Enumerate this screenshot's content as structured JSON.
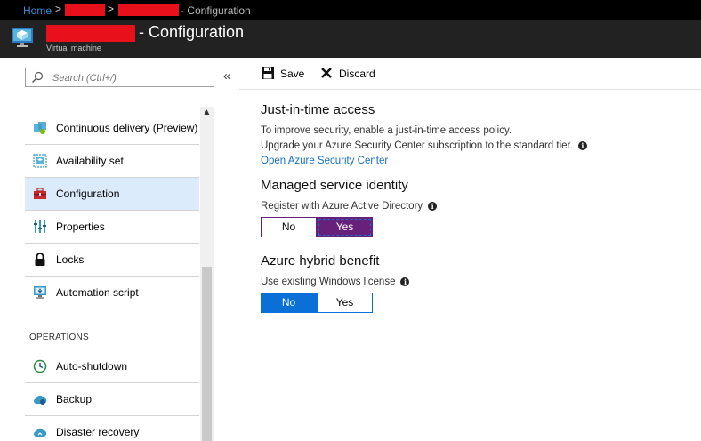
{
  "breadcrumb": {
    "home": "Home",
    "separator": ">",
    "current": "- Configuration"
  },
  "header": {
    "title_suffix": "- Configuration",
    "subtitle": "Virtual machine"
  },
  "sidebar": {
    "search_placeholder": "Search (Ctrl+/)",
    "collapse": "«",
    "items": [
      {
        "label": "Continuous delivery (Preview)",
        "icon": "continuous-delivery-icon"
      },
      {
        "label": "Availability set",
        "icon": "availability-set-icon"
      },
      {
        "label": "Configuration",
        "icon": "toolbox-icon",
        "active": true
      },
      {
        "label": "Properties",
        "icon": "properties-icon"
      },
      {
        "label": "Locks",
        "icon": "lock-icon"
      },
      {
        "label": "Automation script",
        "icon": "automation-script-icon"
      }
    ],
    "section_operations": "OPERATIONS",
    "operations_items": [
      {
        "label": "Auto-shutdown",
        "icon": "clock-icon"
      },
      {
        "label": "Backup",
        "icon": "cloud-backup-icon"
      },
      {
        "label": "Disaster recovery",
        "icon": "cloud-recovery-icon"
      }
    ]
  },
  "toolbar": {
    "save_label": "Save",
    "discard_label": "Discard"
  },
  "main": {
    "jit": {
      "title": "Just-in-time access",
      "line1": "To improve security, enable a just-in-time access policy.",
      "line2": "Upgrade your Azure Security Center subscription to the standard tier.",
      "link": "Open Azure Security Center"
    },
    "msi": {
      "title": "Managed service identity",
      "label": "Register with Azure Active Directory",
      "options": [
        "No",
        "Yes"
      ],
      "selected": "Yes"
    },
    "hybrid": {
      "title": "Azure hybrid benefit",
      "label": "Use existing Windows license",
      "options": [
        "No",
        "Yes"
      ],
      "selected": "No"
    }
  },
  "colors": {
    "accent_blue": "#0a6fd6",
    "accent_purple": "#68217a",
    "link": "#1570c5",
    "redaction": "#e8101a"
  }
}
